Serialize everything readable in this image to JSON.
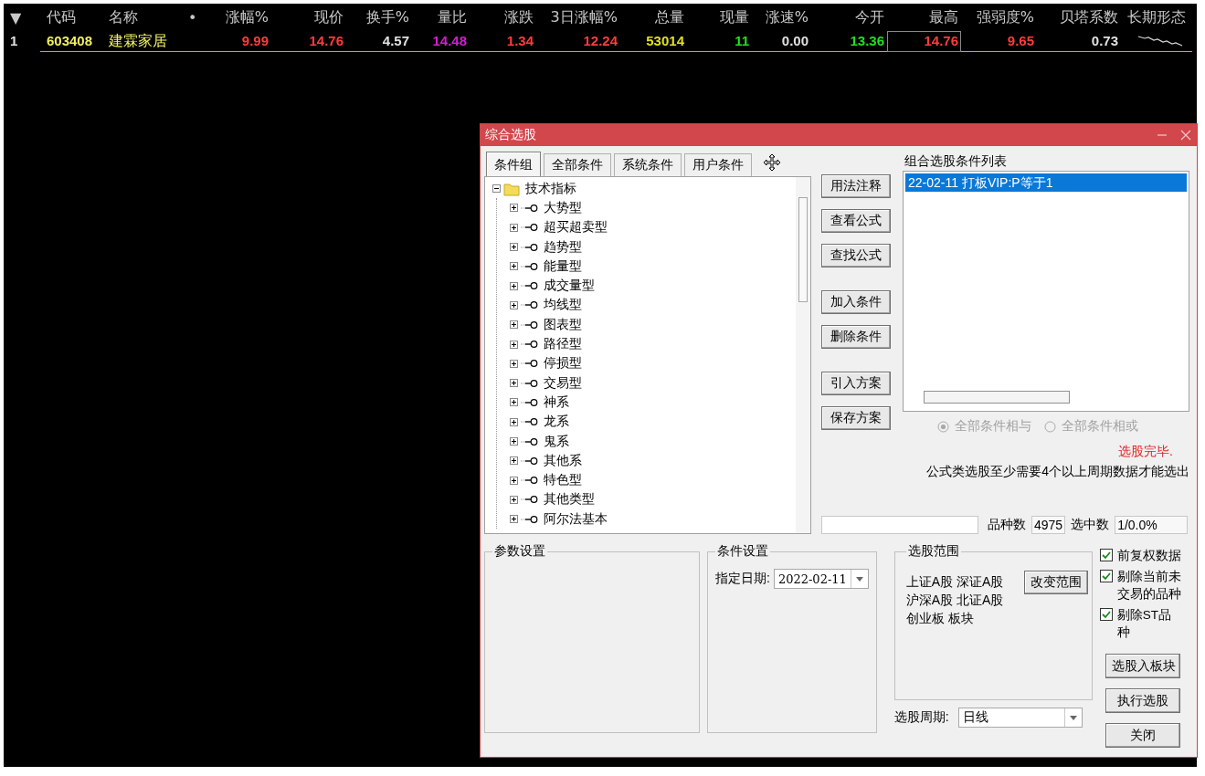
{
  "quote_table": {
    "columns": [
      {
        "label": "▼"
      },
      {
        "label": "代码"
      },
      {
        "label": "名称"
      },
      {
        "label": "•"
      },
      {
        "label": "涨幅%"
      },
      {
        "label": "现价"
      },
      {
        "label": "换手%"
      },
      {
        "label": "量比"
      },
      {
        "label": "涨跌"
      },
      {
        "label": "3日涨幅%"
      },
      {
        "label": "总量"
      },
      {
        "label": "现量"
      },
      {
        "label": "涨速%"
      },
      {
        "label": "今开"
      },
      {
        "label": "最高"
      },
      {
        "label": "强弱度%"
      },
      {
        "label": "贝塔系数"
      },
      {
        "label": "长期形态"
      }
    ],
    "rows": [
      {
        "cells": [
          {
            "kind": "text",
            "text": "1",
            "color": "#e0e0e0",
            "focused": false
          },
          {
            "kind": "text",
            "text": "603408",
            "color": "#f0f060",
            "focused": false
          },
          {
            "kind": "text",
            "text": "建霖家居",
            "color": "#f0f060",
            "focused": false
          },
          {
            "kind": "empty"
          },
          {
            "kind": "text",
            "text": "9.99",
            "color": "#ff3c3c",
            "focused": false
          },
          {
            "kind": "text",
            "text": "14.76",
            "color": "#ff3c3c",
            "focused": false
          },
          {
            "kind": "text",
            "text": "4.57",
            "color": "#e0e0e0",
            "focused": false
          },
          {
            "kind": "text",
            "text": "14.48",
            "color": "#d020d0",
            "focused": false
          },
          {
            "kind": "text",
            "text": "1.34",
            "color": "#ff3c3c",
            "focused": false
          },
          {
            "kind": "text",
            "text": "12.24",
            "color": "#ff3c3c",
            "focused": false
          },
          {
            "kind": "text",
            "text": "53014",
            "color": "#e0e020",
            "focused": false
          },
          {
            "kind": "text",
            "text": "11",
            "color": "#20e020",
            "focused": false
          },
          {
            "kind": "text",
            "text": "0.00",
            "color": "#e0e0e0",
            "focused": false
          },
          {
            "kind": "text",
            "text": "13.36",
            "color": "#20e020",
            "focused": false
          },
          {
            "kind": "text",
            "text": "14.76",
            "color": "#ff3c3c",
            "focused": true
          },
          {
            "kind": "text",
            "text": "9.65",
            "color": "#ff3c3c",
            "focused": false
          },
          {
            "kind": "text",
            "text": "0.73",
            "color": "#e0e0e0",
            "focused": false
          },
          {
            "kind": "sparkline"
          }
        ]
      }
    ]
  },
  "dialog": {
    "title": "综合选股",
    "tabs": [
      {
        "label": "条件组",
        "selected": true
      },
      {
        "label": "全部条件",
        "selected": false
      },
      {
        "label": "系统条件",
        "selected": false
      },
      {
        "label": "用户条件",
        "selected": false
      }
    ],
    "tree": [
      {
        "label": "技术指标",
        "expanded": true,
        "children": [
          {
            "label": "大势型",
            "expanded": false
          },
          {
            "label": "超买超卖型",
            "expanded": false
          },
          {
            "label": "趋势型",
            "expanded": false
          },
          {
            "label": "能量型",
            "expanded": false
          },
          {
            "label": "成交量型",
            "expanded": false
          },
          {
            "label": "均线型",
            "expanded": false
          },
          {
            "label": "图表型",
            "expanded": false
          },
          {
            "label": "路径型",
            "expanded": false
          },
          {
            "label": "停损型",
            "expanded": false
          },
          {
            "label": "交易型",
            "expanded": false
          },
          {
            "label": "神系",
            "expanded": false
          },
          {
            "label": "龙系",
            "expanded": false
          },
          {
            "label": "鬼系",
            "expanded": false
          },
          {
            "label": "其他系",
            "expanded": false
          },
          {
            "label": "特色型",
            "expanded": false
          },
          {
            "label": "其他类型",
            "expanded": false
          },
          {
            "label": "阿尔法基本",
            "expanded": false
          }
        ]
      }
    ],
    "button_groups": [
      [
        "用法注释",
        "查看公式",
        "查找公式"
      ],
      [
        "加入条件",
        "删除条件"
      ],
      [
        "引入方案",
        "保存方案"
      ]
    ],
    "condition_list": {
      "label": "组合选股条件列表",
      "items": [
        {
          "text": "22-02-11 打板VIP:P等于1",
          "selected": true
        }
      ]
    },
    "logic": {
      "disabled": true,
      "options": [
        {
          "label": "全部条件相与",
          "selected": true
        },
        {
          "label": "全部条件相或",
          "selected": false
        }
      ]
    },
    "status": "选股完毕.",
    "note": "公式类选股至少需要4个以上周期数据才能选出",
    "counts": [
      {
        "label": "品种数",
        "value": "4975"
      },
      {
        "label": "选中数",
        "value": "1/0.0%"
      }
    ],
    "param_group": {
      "title": "参数设置"
    },
    "condition_group": {
      "title": "条件设置",
      "date_label": "指定日期:",
      "date": "2022-02-11"
    },
    "range_group": {
      "title": "选股范围",
      "lines": [
        "上证A股 深证A股",
        "沪深A股 北证A股",
        "创业板 板块"
      ],
      "button": "改变范围"
    },
    "period": {
      "label": "选股周期:",
      "value": "日线"
    },
    "options": [
      {
        "label": "前复权数据",
        "checked": true
      },
      {
        "label": "剔除当前未交易的品种",
        "checked": true
      },
      {
        "label": "剔除ST品种",
        "checked": true
      }
    ],
    "action_buttons": [
      "选股入板块",
      "执行选股",
      "关闭"
    ]
  }
}
